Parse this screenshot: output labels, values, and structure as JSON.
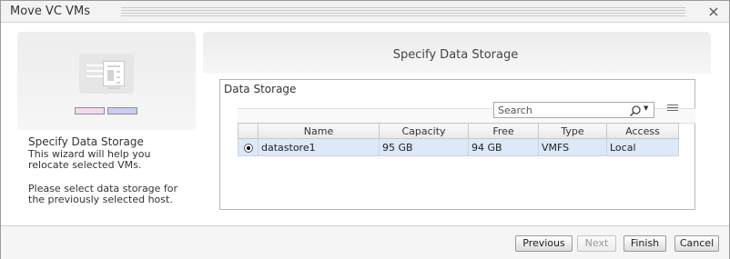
{
  "window": {
    "title": "Move VC VMs"
  },
  "left_panel": {
    "heading": "Specify Data Storage",
    "description": "This wizard will help you relocate selected VMs.",
    "instruction": "Please select data storage for the previously selected host."
  },
  "main": {
    "title": "Specify Data Storage",
    "group_label": "Data Storage",
    "search": {
      "placeholder": "Search",
      "value": ""
    },
    "table": {
      "columns": [
        "Name",
        "Capacity",
        "Free",
        "Type",
        "Access"
      ],
      "rows": [
        {
          "selected": true,
          "name": "datastore1",
          "capacity": "95 GB",
          "free": "94 GB",
          "type": "VMFS",
          "access": "Local"
        }
      ]
    }
  },
  "footer": {
    "previous_label": "Previous",
    "next_label": "Next",
    "finish_label": "Finish",
    "cancel_label": "Cancel"
  }
}
